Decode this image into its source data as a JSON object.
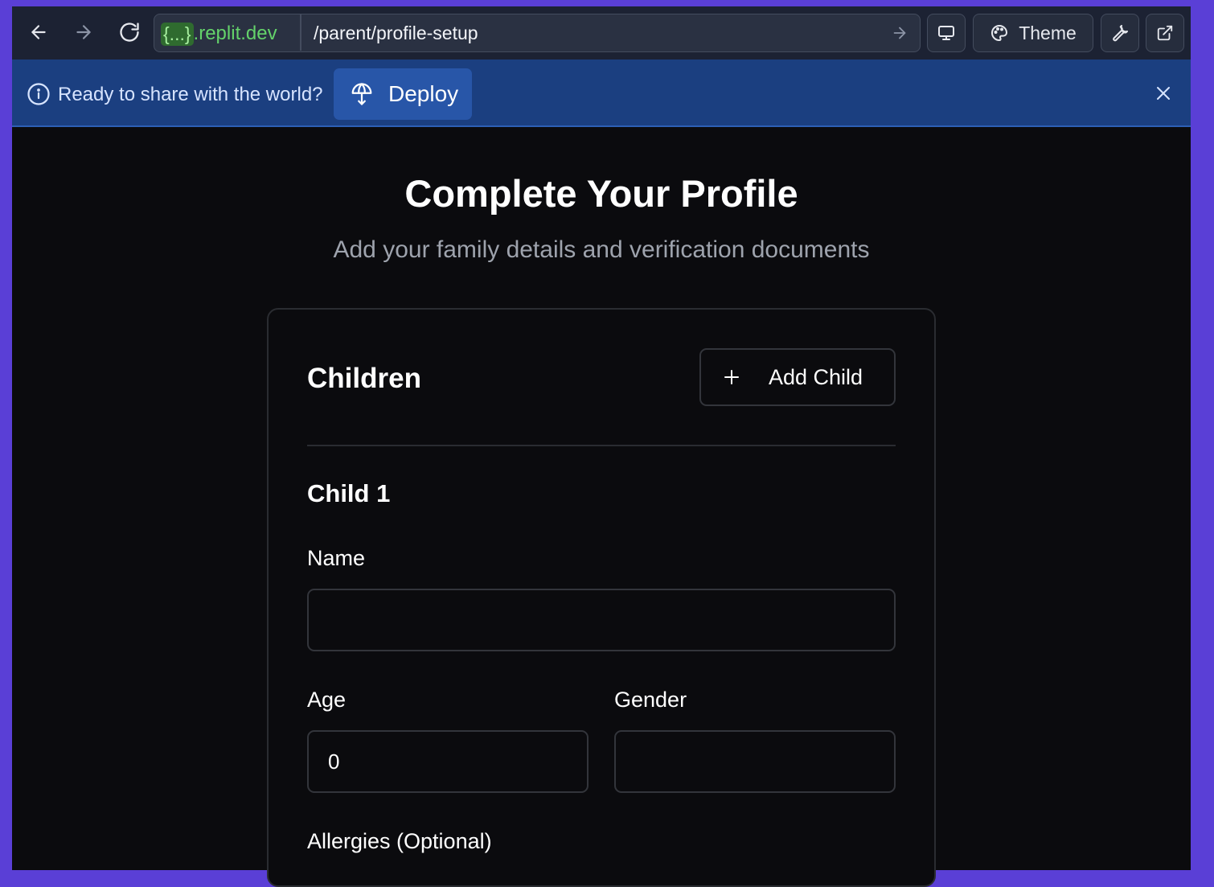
{
  "browser": {
    "url_domain_prefix": "{...}",
    "url_domain_suffix": ".replit.dev",
    "url_path": "/parent/profile-setup",
    "theme_label": "Theme"
  },
  "banner": {
    "message": "Ready to share with the world?",
    "deploy_label": "Deploy"
  },
  "page": {
    "title": "Complete Your Profile",
    "subtitle": "Add your family details and verification documents"
  },
  "children_section": {
    "title": "Children",
    "add_child_label": "Add Child",
    "child": {
      "heading": "Child 1",
      "name_label": "Name",
      "name_value": "",
      "age_label": "Age",
      "age_value": "0",
      "gender_label": "Gender",
      "gender_value": "",
      "allergies_label": "Allergies (Optional)"
    }
  },
  "colors": {
    "page_bg": "#0b0b0e",
    "banner_bg": "#1b3f80",
    "deploy_bg": "#2856a8",
    "frame_accent": "#5a3fd6",
    "domain_green": "#64d26a"
  }
}
